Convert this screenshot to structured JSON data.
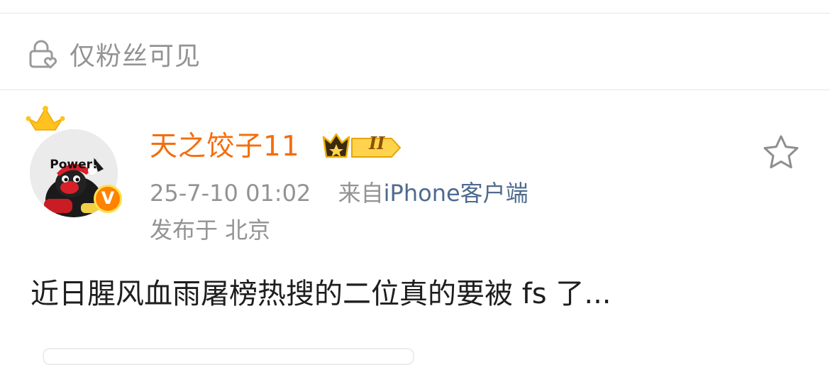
{
  "visibility": {
    "label": "仅粉丝可见",
    "icon": "lock-heart-icon"
  },
  "post": {
    "author": {
      "name": "天之饺子11",
      "avatar_text": "Power!",
      "verified_mark": "V",
      "vip_level": "II",
      "colors": {
        "name": "#f56d0b",
        "verified": "#ff8200"
      }
    },
    "timestamp": "25-7-10 01:02",
    "source_prefix": "来自",
    "source": "iPhone客户端",
    "location": "发布于 北京",
    "text": "近日腥风血雨屠榜热搜的二位真的要被 fs 了..."
  },
  "actions": {
    "favorite_icon": "star-outline-icon"
  }
}
